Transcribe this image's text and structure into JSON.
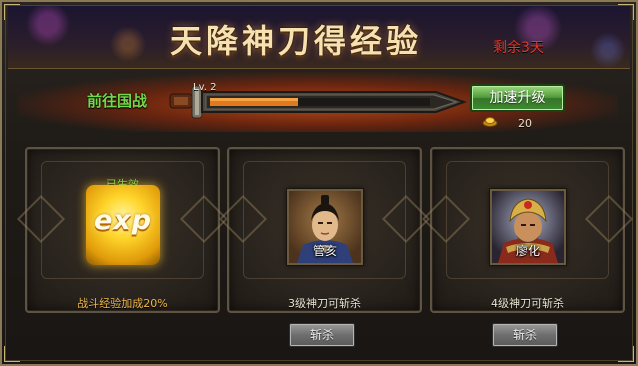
{
  "header": {
    "title": "天降神刀得经验",
    "remaining": "剩余3天"
  },
  "progress": {
    "goto_label": "前往国战",
    "level_label": "Lv. 2",
    "fill_fraction": 0.4,
    "speedup_label": "加速升级",
    "cost_value": "20"
  },
  "cards": [
    {
      "kind": "exp-bonus",
      "status": "已生效",
      "icon_text": "exp",
      "caption": "战斗经验加成20%"
    },
    {
      "kind": "general",
      "name": "管亥",
      "caption": "3级神刀可斩杀",
      "button_label": "斩杀"
    },
    {
      "kind": "general",
      "name": "廖化",
      "caption": "4级神刀可斩杀",
      "button_label": "斩杀"
    }
  ],
  "colors": {
    "title": "#f7e1b0",
    "remaining": "#e3372a",
    "goto": "#73d84a",
    "progress_fill": "#e07a1c",
    "status": "#6fd24d",
    "bonus_caption": "#f0b64a"
  }
}
